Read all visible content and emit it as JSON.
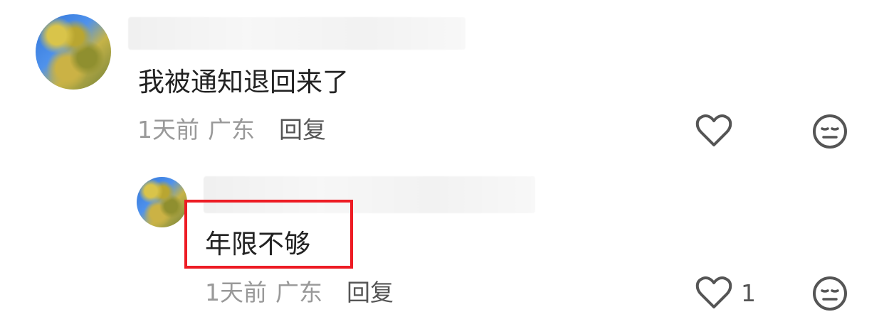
{
  "comments": [
    {
      "text": "我被通知退回来了",
      "time": "1天前",
      "location": "广东",
      "reply_label": "回复",
      "like_count": ""
    }
  ],
  "reply": {
    "text": "年限不够",
    "time": "1天前",
    "location": "广东",
    "reply_label": "回复",
    "like_count": "1"
  },
  "icons": {
    "like": "heart-outline-icon",
    "dislike": "neutral-face-icon"
  },
  "colors": {
    "highlight": "#ed1c24",
    "meta_text": "#999999",
    "reply_text": "#555555",
    "body_text": "#222222"
  }
}
